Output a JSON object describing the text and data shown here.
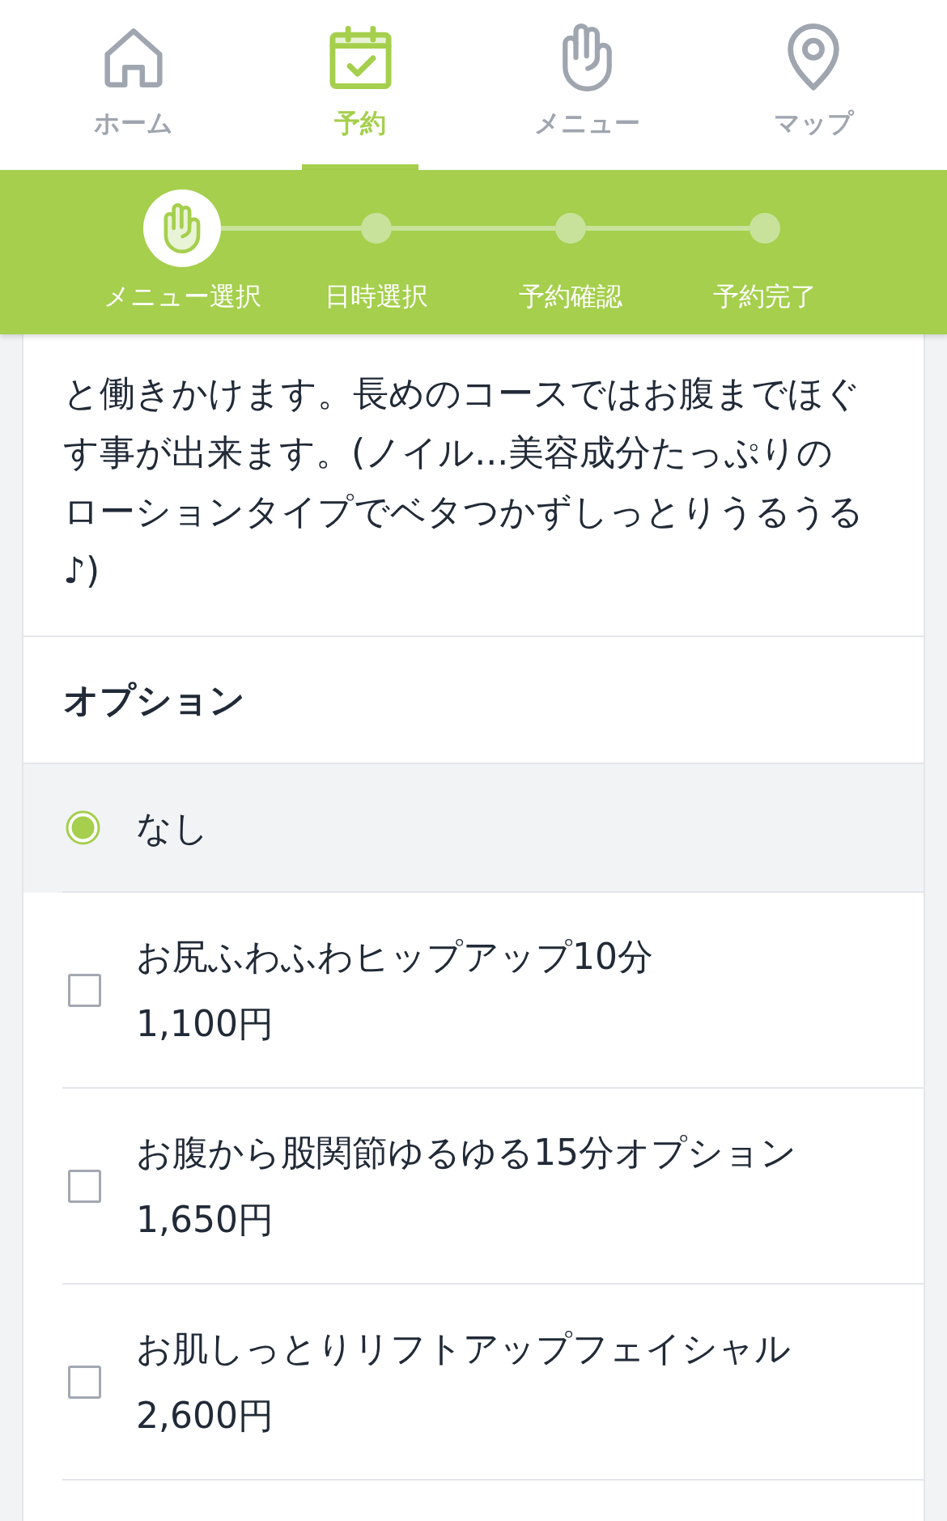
{
  "nav_tabs": [
    {
      "label": "ホーム",
      "selected": false
    },
    {
      "label": "予約",
      "selected": true
    },
    {
      "label": "メニュー",
      "selected": false
    },
    {
      "label": "マップ",
      "selected": false
    }
  ],
  "steps": [
    {
      "label": "メニュー選択",
      "current": true
    },
    {
      "label": "日時選択",
      "current": false
    },
    {
      "label": "予約確認",
      "current": false
    },
    {
      "label": "予約完了",
      "current": false
    }
  ],
  "description": "と働きかけます。長めのコースではお腹までほぐす事が出来ます。(ノイル...美容成分たっぷりのローションタイプでベタつかずしっとりうるうる♪)",
  "options": {
    "title": "オプション",
    "items": [
      {
        "kind": "radio",
        "label": "なし",
        "selected": true
      },
      {
        "kind": "checkbox",
        "label": "お尻ふわふわヒップアップ10分",
        "price": "1,100円",
        "selected": false
      },
      {
        "kind": "checkbox",
        "label": "お腹から股関節ゆるゆる15分オプション",
        "price": "1,650円",
        "selected": false
      },
      {
        "kind": "checkbox",
        "label": "お肌しっとりリフトアップフェイシャル",
        "price": "2,600円",
        "selected": false
      }
    ]
  }
}
